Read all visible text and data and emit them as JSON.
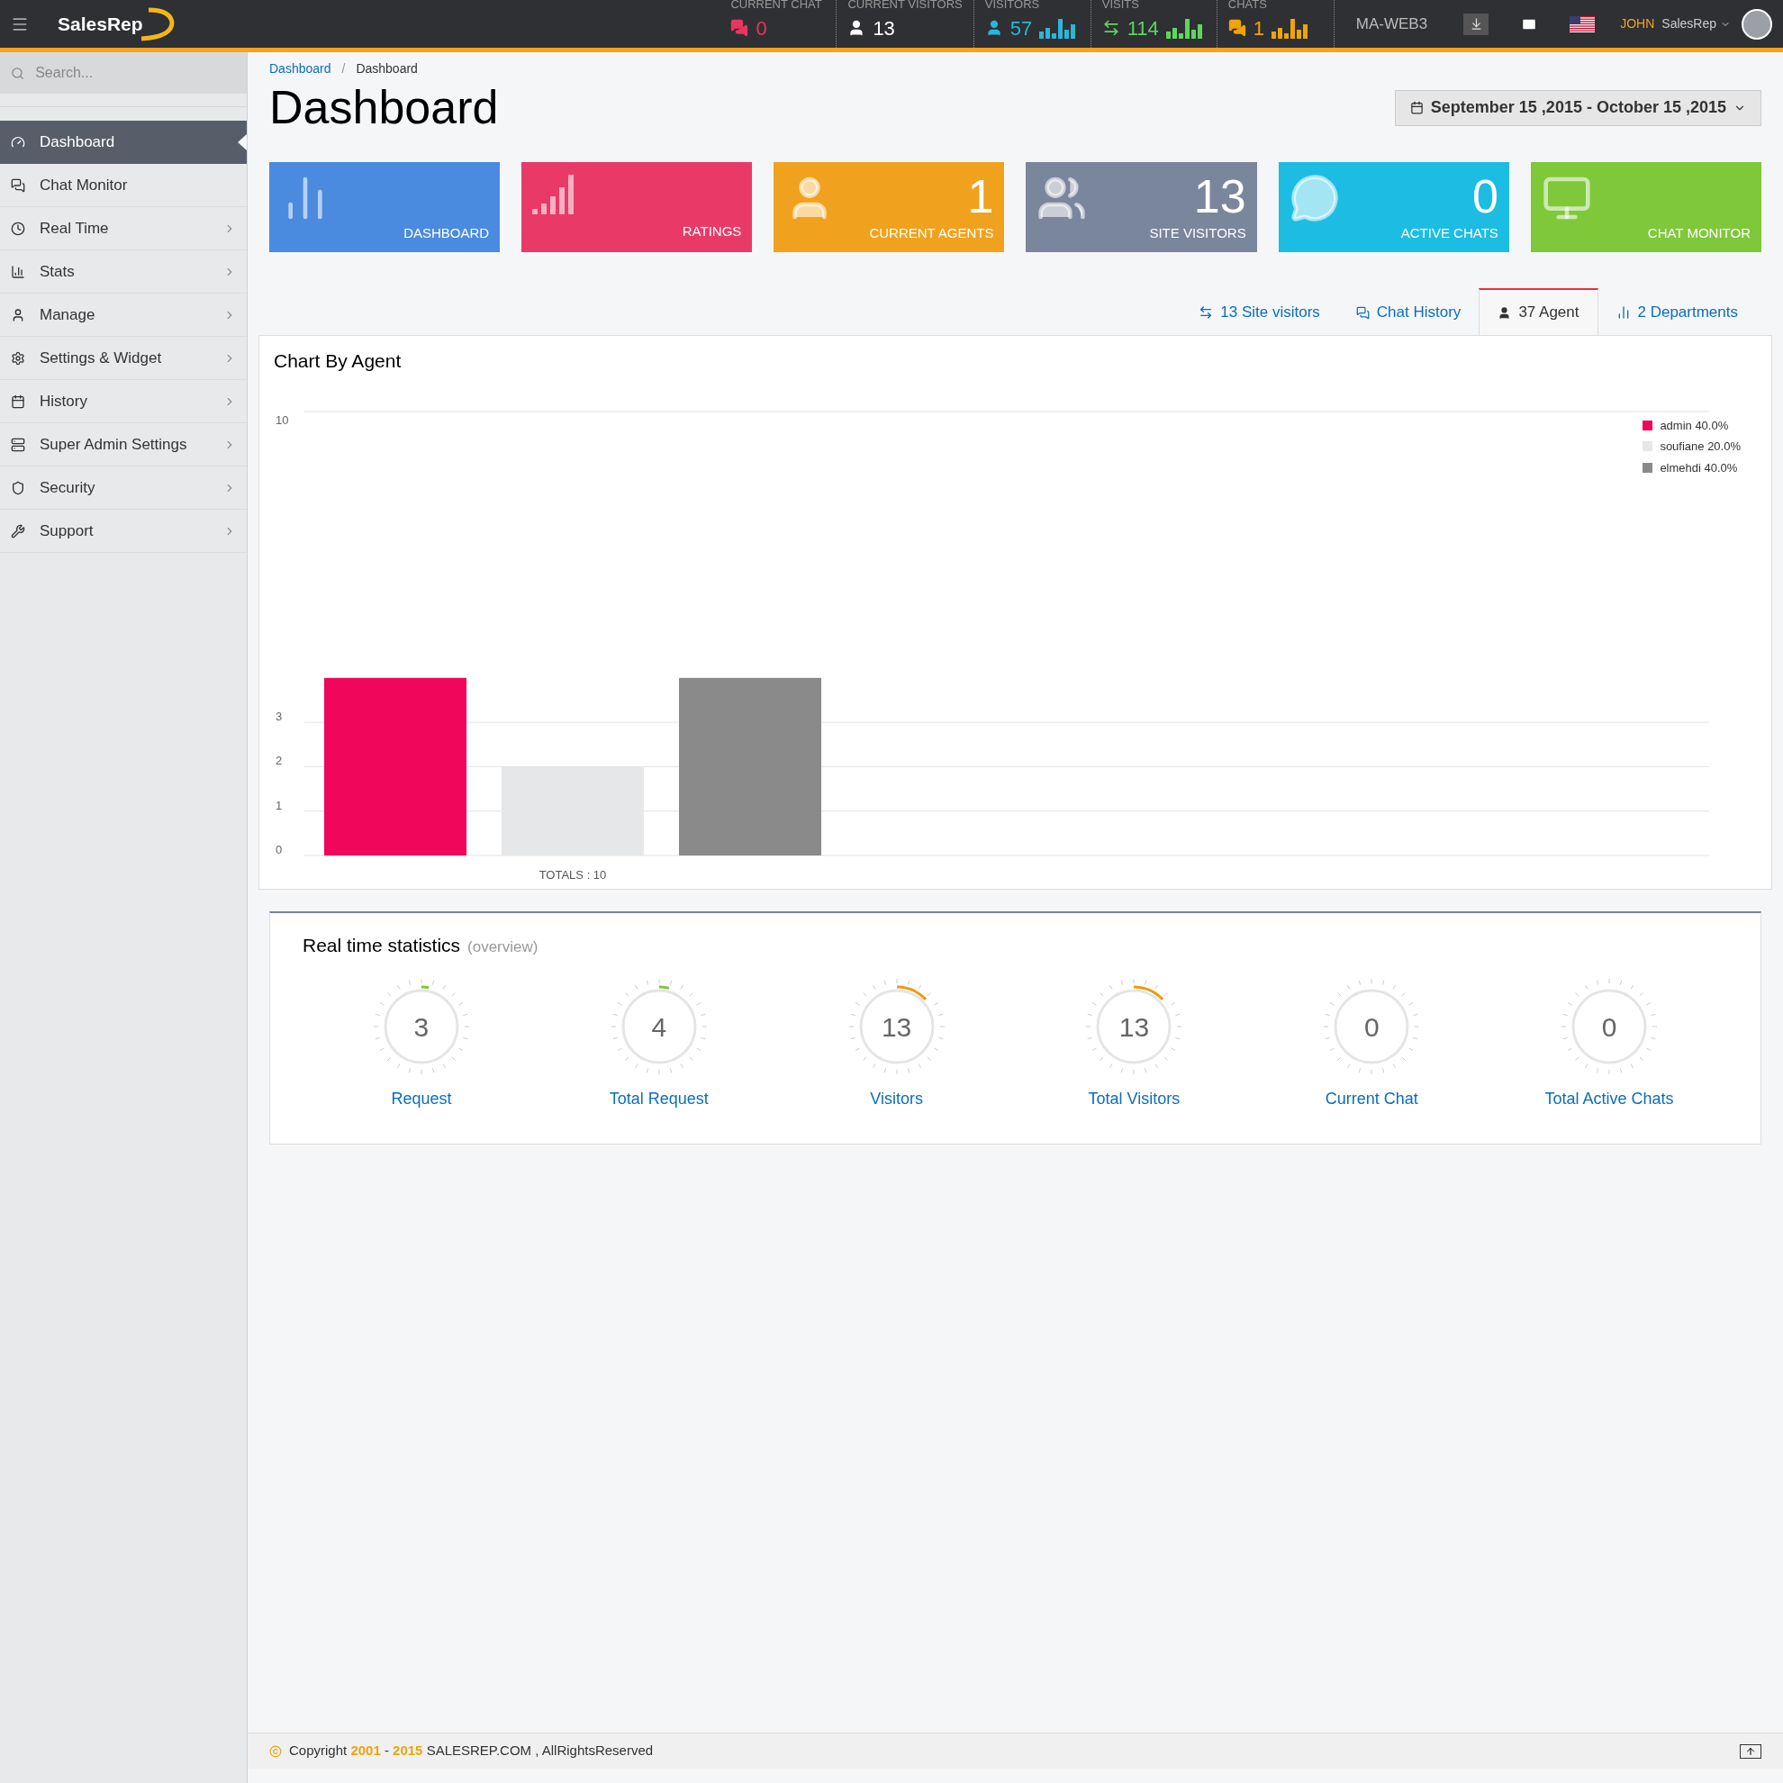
{
  "topbar": {
    "brand": "SalesRep",
    "stats": [
      {
        "label": "CURRENT CHAT",
        "value": "0",
        "color": "#e8365d",
        "sparkline": false
      },
      {
        "label": "CURRENT VISITORS",
        "value": "13",
        "color": "#ffffff",
        "sparkline": false
      },
      {
        "label": "VISITORS",
        "value": "57",
        "color": "#2bb5d8",
        "sparkline": true
      },
      {
        "label": "VISITS",
        "value": "114",
        "color": "#5cd65c",
        "sparkline": true
      },
      {
        "label": "CHATS",
        "value": "1",
        "color": "#f0a30a",
        "sparkline": true
      }
    ],
    "server": "MA-WEB3",
    "user_first": "JOHN",
    "user_name": "SalesRep"
  },
  "sidebar": {
    "search_placeholder": "Search...",
    "items": [
      {
        "label": "Dashboard",
        "selected": true,
        "expandable": false
      },
      {
        "label": "Chat Monitor",
        "selected": false,
        "expandable": false
      },
      {
        "label": "Real Time",
        "selected": false,
        "expandable": true
      },
      {
        "label": "Stats",
        "selected": false,
        "expandable": true
      },
      {
        "label": "Manage",
        "selected": false,
        "expandable": true
      },
      {
        "label": "Settings & Widget",
        "selected": false,
        "expandable": true
      },
      {
        "label": "History",
        "selected": false,
        "expandable": true
      },
      {
        "label": "Super Admin Settings",
        "selected": false,
        "expandable": true
      },
      {
        "label": "Security",
        "selected": false,
        "expandable": true
      },
      {
        "label": "Support",
        "selected": false,
        "expandable": true
      }
    ]
  },
  "breadcrumb": {
    "items": [
      "Dashboard",
      "Dashboard"
    ],
    "separator": "/"
  },
  "title": "Dashboard",
  "date_range": "September 15 ,2015 - October 15 ,2015",
  "tiles": [
    {
      "label": "DASHBOARD",
      "color": "#4a8be0"
    },
    {
      "label": "RATINGS",
      "color": "#e93a67"
    },
    {
      "label": "CURRENT AGENTS",
      "value": "1",
      "color": "#f0a21f"
    },
    {
      "label": "SITE VISITORS",
      "value": "13",
      "color": "#7a869c"
    },
    {
      "label": "ACTIVE CHATS",
      "value": "0",
      "color": "#1dbde3"
    },
    {
      "label": "CHAT MONITOR",
      "color": "#7ec83a"
    }
  ],
  "tabs": [
    {
      "label": "13 Site visitors",
      "selected": false
    },
    {
      "label": "Chat History",
      "selected": false
    },
    {
      "label": "37 Agent",
      "selected": true
    },
    {
      "label": "2 Departments",
      "selected": false
    }
  ],
  "chart": {
    "title": "Chart By Agent",
    "chart_data": {
      "type": "bar",
      "categories": [
        "TOTALS : 10"
      ],
      "series": [
        {
          "name": "admin 40.0%",
          "color": "#f0065b",
          "values": [
            4
          ]
        },
        {
          "name": "soufiane 20.0%",
          "color": "#e6e7e9",
          "values": [
            2
          ]
        },
        {
          "name": "elmehdi 40.0%",
          "color": "#8a8a8a",
          "values": [
            4
          ]
        }
      ],
      "ylim": [
        0,
        10
      ],
      "yticks": [
        0,
        1,
        2,
        3,
        10
      ],
      "grid": true
    }
  },
  "realtime": {
    "title": "Real time statistics",
    "subtitle": "(overview)",
    "gauges": [
      {
        "value": "3",
        "label": "Request",
        "color": "#7ec83a"
      },
      {
        "value": "4",
        "label": "Total Request",
        "color": "#7ec83a"
      },
      {
        "value": "13",
        "label": "Visitors",
        "color": "#f09a0a"
      },
      {
        "value": "13",
        "label": "Total Visitors",
        "color": "#f09a0a"
      },
      {
        "value": "0",
        "label": "Current Chat"
      },
      {
        "value": "0",
        "label": "Total Active Chats"
      }
    ]
  },
  "footer": {
    "text": "Copyright **2001** - **2015** SALESREP.COM , AllRightsReserved"
  }
}
